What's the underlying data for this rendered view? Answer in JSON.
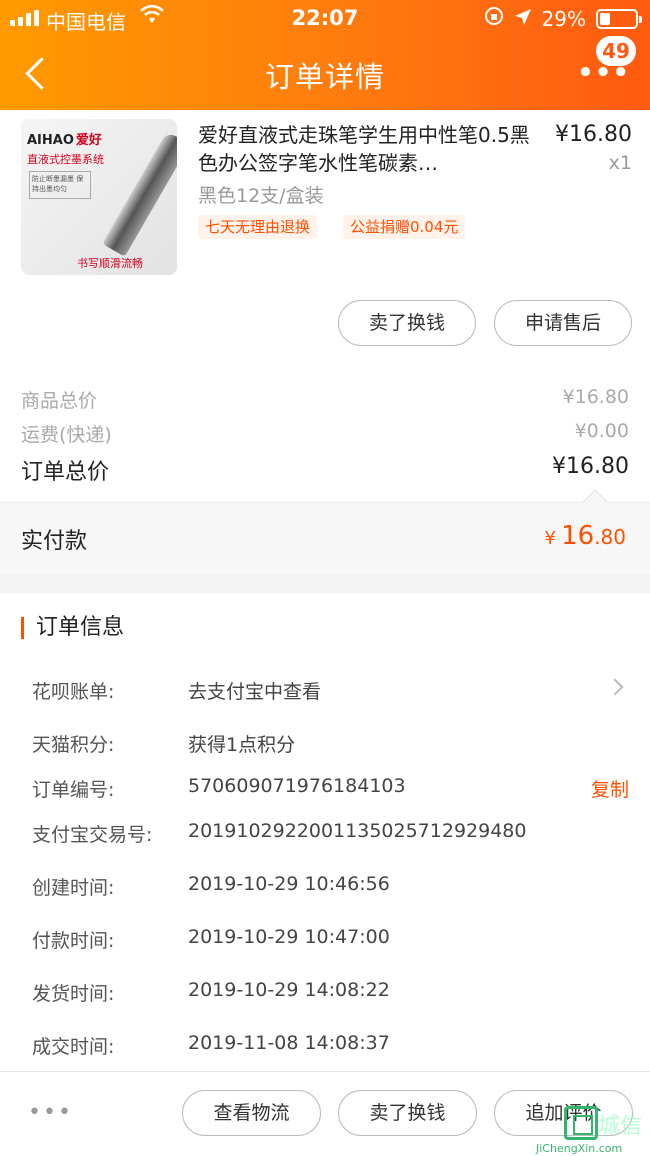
{
  "status_bar": {
    "carrier": "中国电信",
    "time": "22:07",
    "battery": "29%",
    "battery_level": 0.29
  },
  "nav": {
    "title": "订单详情",
    "badge": "49"
  },
  "product": {
    "title": "爱好直液式走珠笔学生用中性笔0.5黑色办公签字笔水性笔碳素…",
    "price": "¥16.80",
    "qty": "x1",
    "sku": "黑色12支/盒装",
    "tags": [
      "七天无理由退换",
      "公益捐赠0.04元"
    ],
    "image_text": {
      "brand": "AIHAO",
      "brand_cn": "爱好",
      "system": "直液式控墨系统",
      "note": "防止断墨漏墨 保持出墨均匀",
      "smooth": "书写顺滑流畅"
    },
    "buttons": {
      "sell": "卖了换钱",
      "after_sale": "申请售后"
    }
  },
  "summary": {
    "goods_label": "商品总价",
    "goods_value": "¥16.80",
    "shipping_label": "运费(快递)",
    "shipping_value": "¥0.00",
    "total_label": "订单总价",
    "total_value": "¥16.80"
  },
  "paid": {
    "label": "实付款",
    "symbol": "¥",
    "integer": "16",
    "decimal": ".80"
  },
  "order_info": {
    "header": "订单信息",
    "rows": [
      {
        "key": "花呗账单:",
        "value": "去支付宝中查看"
      },
      {
        "key": "天猫积分:",
        "value": "获得1点积分"
      },
      {
        "key": "订单编号:",
        "value": "570609071976184103",
        "action": "复制"
      },
      {
        "key": "支付宝交易号:",
        "value": "2019102922001135025712929480"
      },
      {
        "key": "创建时间:",
        "value": "2019-10-29 10:46:56"
      },
      {
        "key": "付款时间:",
        "value": "2019-10-29 10:47:00"
      },
      {
        "key": "发货时间:",
        "value": "2019-10-29 14:08:22"
      },
      {
        "key": "成交时间:",
        "value": "2019-11-08 14:08:37"
      }
    ]
  },
  "bottom_bar": {
    "more": "•••",
    "logistics": "查看物流",
    "sell": "卖了换钱",
    "review": "追加评价"
  },
  "watermark": {
    "text": "城信",
    "url": "JiChengXin.com"
  },
  "colors": {
    "accent": "#ff5000",
    "header_start": "#ff9a00",
    "header_end": "#ff5a10"
  }
}
